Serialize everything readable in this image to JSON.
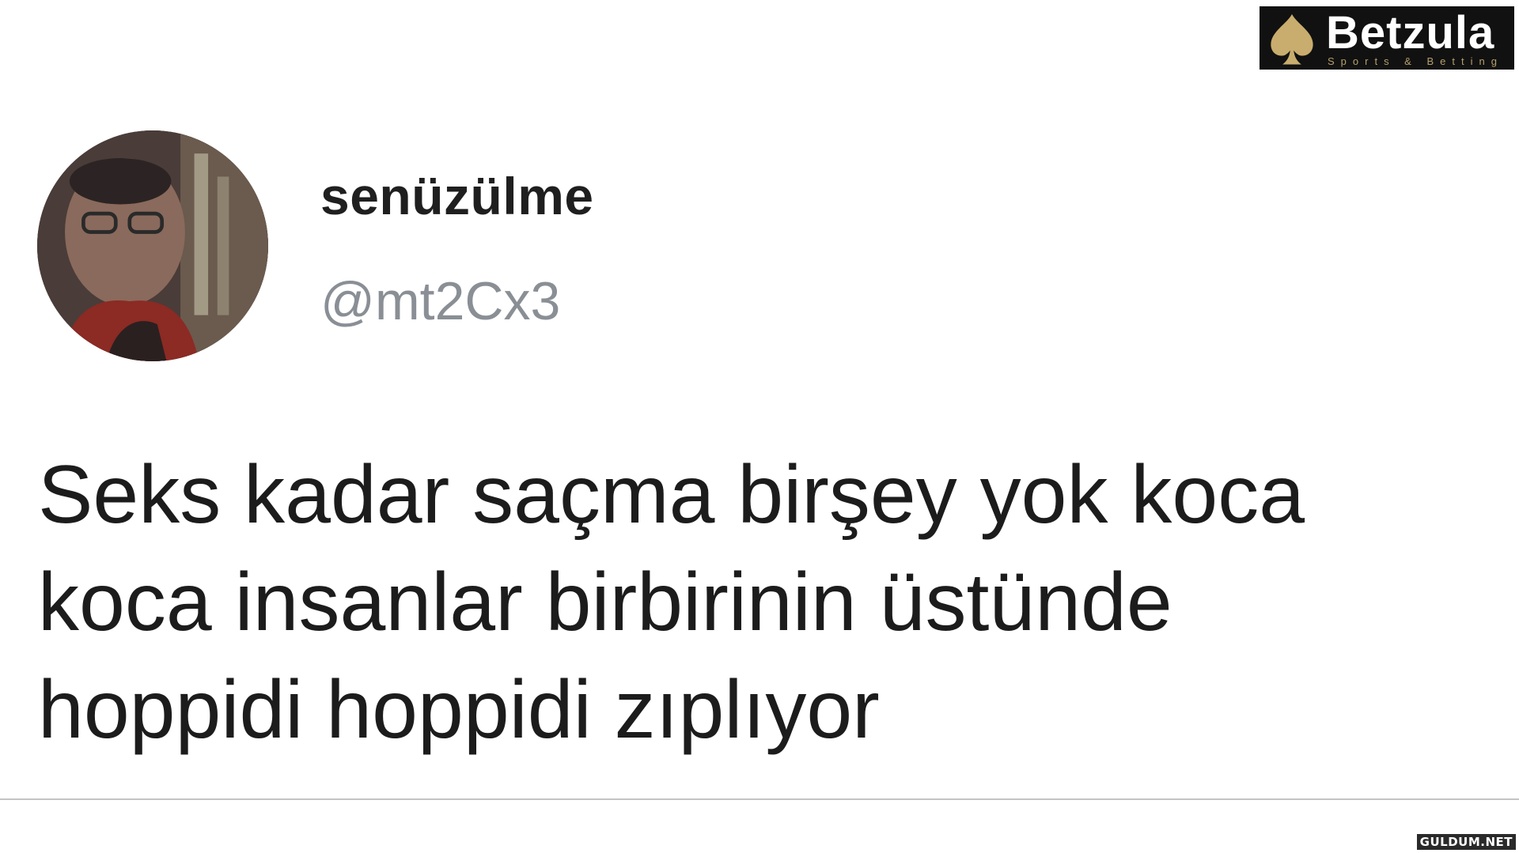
{
  "brand": {
    "name": "Betzula",
    "tagline": "Sports & Betting",
    "icon": "spade-icon",
    "colors": {
      "background": "#111111",
      "gold": "#c9ad6e"
    }
  },
  "tweet": {
    "avatar_icon": "user-avatar",
    "display_name": "senüzülme",
    "handle": "@mt2Cx3",
    "text_lines": [
      "Seks kadar saçma birşey yok koca",
      "koca insanlar birbirinin üstünde",
      "hoppidi hoppidi zıplıyor"
    ],
    "colors": {
      "name": "#1f1f1f",
      "handle": "#8a8f96",
      "text": "#1c1c1c"
    }
  },
  "watermark": {
    "text": "GULDUM.NET"
  }
}
